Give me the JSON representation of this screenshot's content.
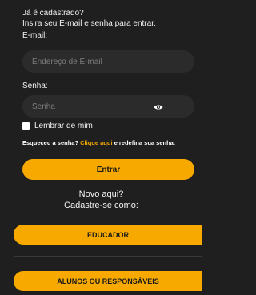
{
  "login": {
    "question": "Já é cadastrado?",
    "instruction": "Insira seu E-mail e senha para entrar.",
    "email_label": "E-mail:",
    "email_placeholder": "Endereço de E-mail",
    "password_label": "Senha:",
    "password_placeholder": "Senha",
    "remember_label": "Lembrar de mim",
    "forgot_prefix": "Esqueceu a senha? ",
    "forgot_link": "Clique aqui",
    "forgot_suffix": " e redefina sua senha.",
    "submit_label": "Entrar"
  },
  "register": {
    "line1": "Novo aqui?",
    "line2": "Cadastre-se como:",
    "educator_label": "EDUCADOR",
    "students_label": "ALUNOS OU RESPONSÁVEIS"
  },
  "colors": {
    "background": "#1f1f1f",
    "field": "#2b2b2b",
    "accent": "#f7a900",
    "text": "#f2f2f2"
  },
  "icons": {
    "password_toggle": "eye-icon"
  }
}
